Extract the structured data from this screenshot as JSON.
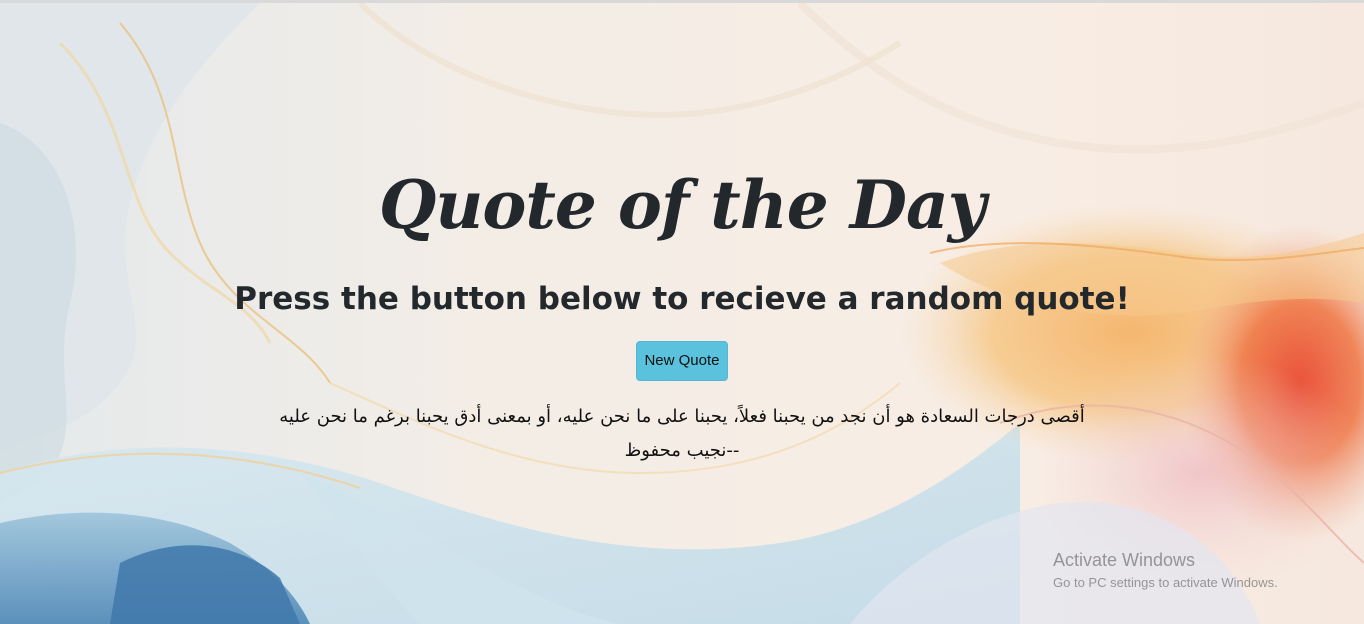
{
  "page": {
    "title": "Quote of the Day",
    "subtitle": "Press the button below to recieve a random quote!",
    "button_label": "New Quote",
    "quote": "أقصى درجات السعادة هو أن نجد من يحبنا فعلاً، يحبنا على ما نحن عليه، أو بمعنى أدق يحبنا برغم ما نحن عليه",
    "author": "--نجيب محفوظ"
  },
  "watermark": {
    "line1": "Activate Windows",
    "line2": "Go to PC settings to activate Windows."
  },
  "colors": {
    "button": "#5bc2dd",
    "text": "#23282d"
  }
}
